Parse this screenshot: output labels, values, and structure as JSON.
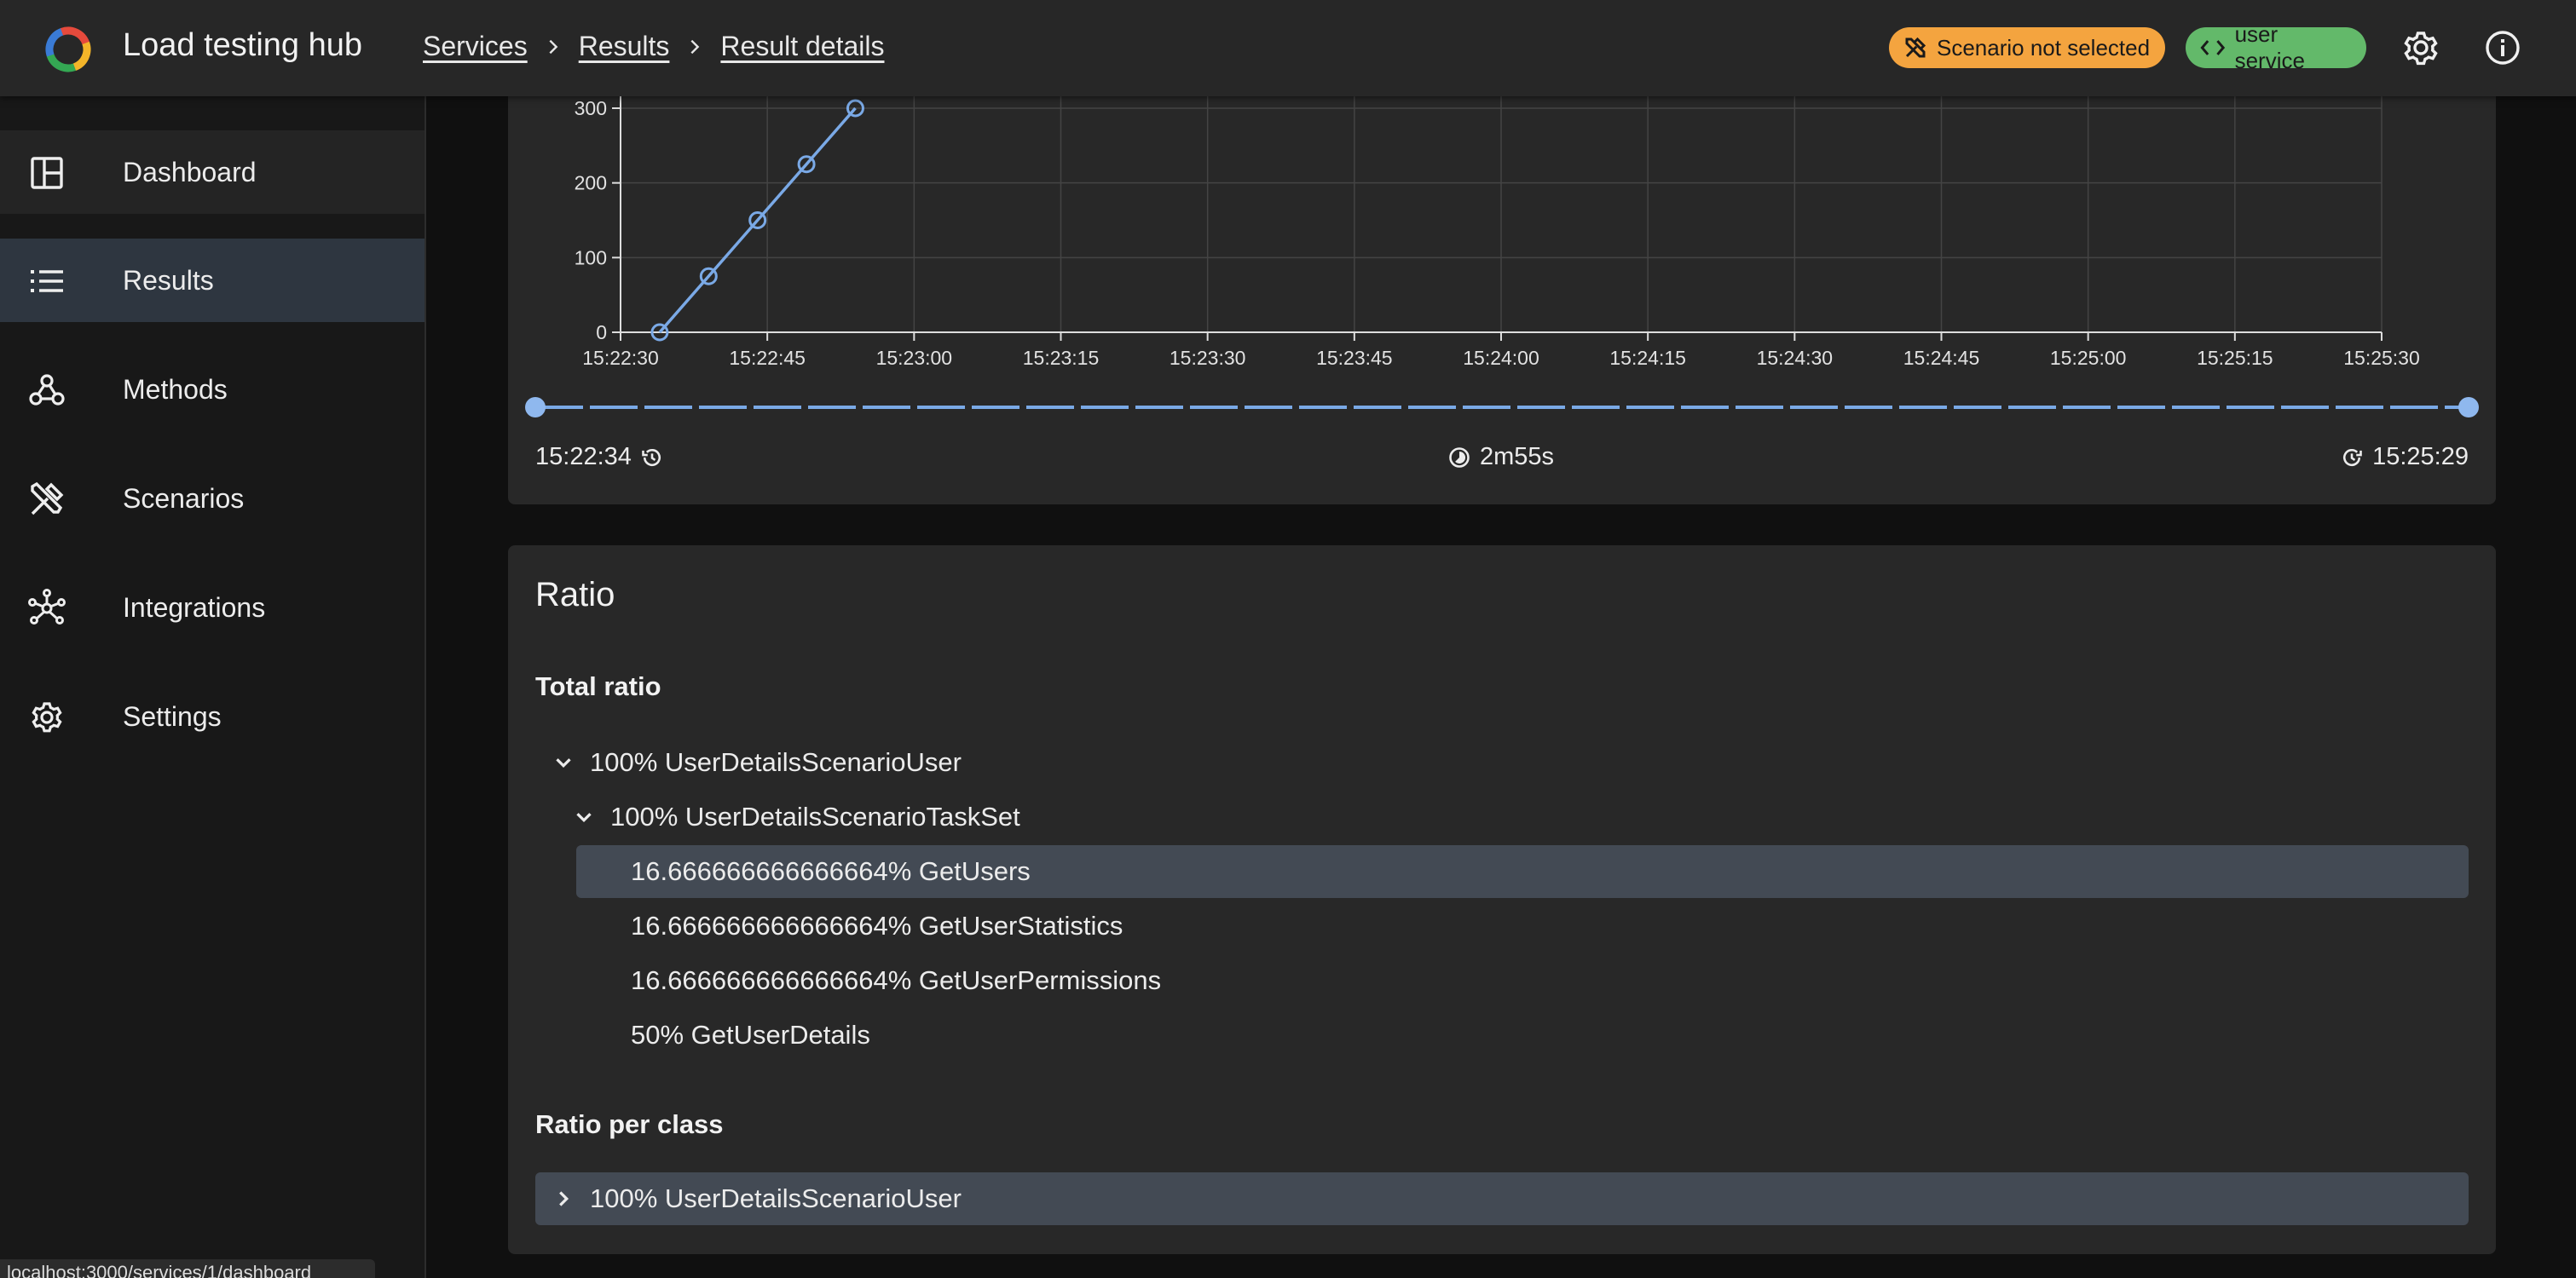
{
  "header": {
    "app_title": "Load testing hub",
    "breadcrumbs": [
      {
        "label": "Services"
      },
      {
        "label": "Results"
      },
      {
        "label": "Result details"
      }
    ],
    "scenario_chip": "Scenario not selected",
    "service_chip": "user service",
    "colors": {
      "scenario_chip": "#f4a43f",
      "service_chip": "#63b96a"
    }
  },
  "sidebar": {
    "items": [
      {
        "label": "Dashboard",
        "icon": "dashboard-icon"
      },
      {
        "label": "Results",
        "icon": "list-icon",
        "active": true
      },
      {
        "label": "Methods",
        "icon": "webhook-icon"
      },
      {
        "label": "Scenarios",
        "icon": "tools-icon"
      },
      {
        "label": "Integrations",
        "icon": "hub-icon"
      },
      {
        "label": "Settings",
        "icon": "gear-icon"
      }
    ]
  },
  "chart_data": {
    "type": "line",
    "x_ticks": [
      "15:22:30",
      "15:22:45",
      "15:23:00",
      "15:23:15",
      "15:23:30",
      "15:23:45",
      "15:24:00",
      "15:24:15",
      "15:24:30",
      "15:24:45",
      "15:25:00",
      "15:25:15",
      "15:25:30"
    ],
    "y_ticks": [
      "0",
      "100",
      "200",
      "300"
    ],
    "x_seconds_from_15_22_30": [
      4,
      9,
      14,
      19,
      24
    ],
    "values": [
      0,
      75,
      150,
      225,
      300
    ],
    "grid": true,
    "series_color": "#7aa9e6"
  },
  "range": {
    "start": "15:22:34",
    "duration": "2m55s",
    "end": "15:25:29"
  },
  "ratio": {
    "title": "Ratio",
    "total_title": "Total ratio",
    "total_tree": [
      {
        "label": "100% UserDetailsScenarioUser",
        "expanded": true
      },
      {
        "label": "100% UserDetailsScenarioTaskSet",
        "expanded": true
      },
      {
        "label": "16.666666666666664% GetUsers",
        "selected": true
      },
      {
        "label": "16.666666666666664% GetUserStatistics"
      },
      {
        "label": "16.666666666666664% GetUserPermissions"
      },
      {
        "label": "50% GetUserDetails"
      }
    ],
    "per_class_title": "Ratio per class",
    "per_class_tree": [
      {
        "label": "100% UserDetailsScenarioUser",
        "expanded": false
      }
    ]
  },
  "status_bar": {
    "url": "localhost:3000/services/1/dashboard"
  }
}
